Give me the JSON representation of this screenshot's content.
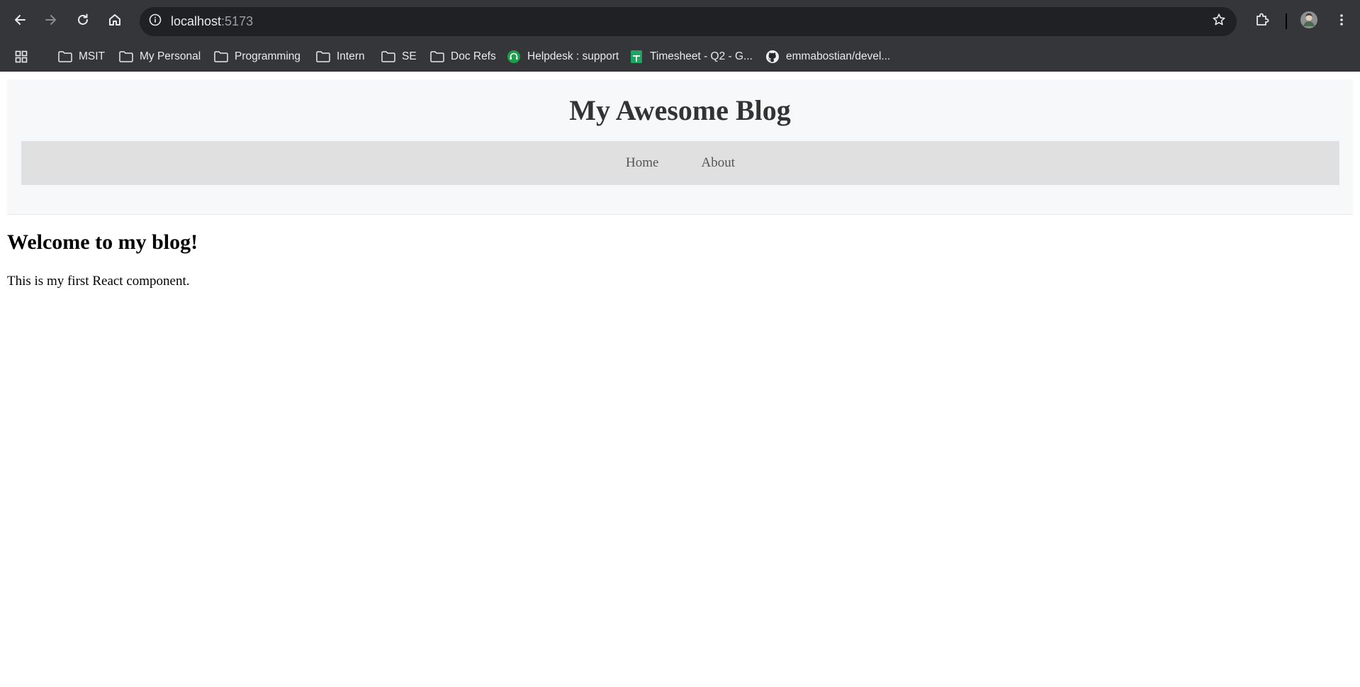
{
  "browser": {
    "url_host": "localhost",
    "url_port": ":5173",
    "icons": {
      "back": "arrow-left-icon",
      "forward": "arrow-right-icon",
      "reload": "reload-icon",
      "home": "home-icon",
      "site_info": "info-icon",
      "bookmark_star": "star-icon",
      "extensions": "puzzle-icon",
      "profile": "avatar",
      "menu": "vertical-dots-icon"
    }
  },
  "bookmarks": [
    {
      "label": "MSIT",
      "icon": "folder-icon"
    },
    {
      "label": "My Personal",
      "icon": "folder-icon"
    },
    {
      "label": "Programming",
      "icon": "folder-icon"
    },
    {
      "label": "Intern",
      "icon": "folder-icon"
    },
    {
      "label": "SE",
      "icon": "folder-icon"
    },
    {
      "label": "Doc Refs",
      "icon": "folder-icon"
    },
    {
      "label": "Helpdesk : support",
      "icon": "helpdesk-icon"
    },
    {
      "label": "Timesheet - Q2 - G...",
      "icon": "sheets-icon"
    },
    {
      "label": "emmabostian/devel...",
      "icon": "github-icon"
    }
  ],
  "page": {
    "site_title": "My Awesome Blog",
    "nav": [
      {
        "label": "Home"
      },
      {
        "label": "About"
      }
    ],
    "heading": "Welcome to my blog!",
    "body_text": "This is my first React component."
  },
  "colors": {
    "chrome_bg": "#35363a",
    "omnibox_bg": "#202124",
    "header_bg": "#f7f8f9",
    "nav_bg": "#e0e0e0",
    "title_color": "#333333",
    "nav_link_color": "#555555"
  }
}
